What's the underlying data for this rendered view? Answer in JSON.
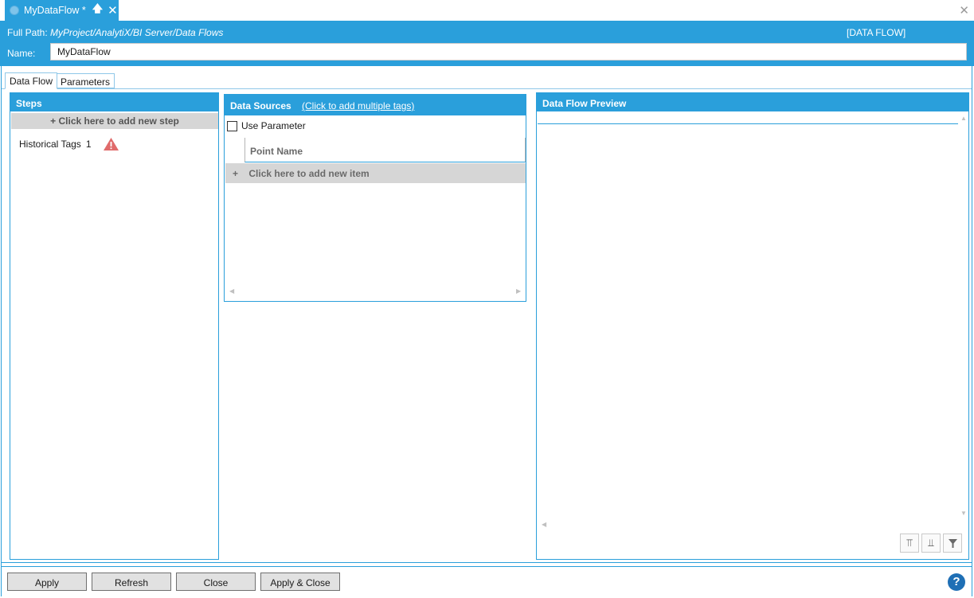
{
  "tab": {
    "title": "MyDataFlow *",
    "pin_icon": "pin-up-arrow-icon",
    "close_icon": "close-icon"
  },
  "window": {
    "close_icon": "close-icon"
  },
  "header": {
    "full_path_label": "Full Path:",
    "full_path_value": "MyProject/AnalytiX/BI Server/Data Flows",
    "kind": "[DATA FLOW]",
    "name_label": "Name:",
    "name_value": "MyDataFlow"
  },
  "subtabs": [
    {
      "label": "Data Flow",
      "selected": true
    },
    {
      "label": "Parameters",
      "selected": false
    }
  ],
  "steps": {
    "title": "Steps",
    "add_label": "+  Click here to add new step",
    "items": [
      {
        "label": "Historical Tags",
        "count": "1",
        "status_icon": "warning-icon"
      }
    ]
  },
  "data_sources": {
    "title": "Data Sources",
    "link": "(Click to add multiple tags)",
    "use_parameter_label": "Use Parameter",
    "use_parameter_checked": false,
    "column_header": "Point Name",
    "add_item_label": "Click here to add new item"
  },
  "preview": {
    "title": "Data Flow Preview",
    "toolbar_icons": [
      "column-add-icon",
      "column-remove-icon",
      "filter-icon"
    ]
  },
  "footer": {
    "buttons": [
      "Apply",
      "Refresh",
      "Close",
      "Apply & Close"
    ],
    "help_icon": "help-icon",
    "help_glyph": "?"
  },
  "colors": {
    "accent": "#2a9fdb",
    "button_bg": "#e1e1e1",
    "add_row_bg": "#d6d6d6",
    "warning": "#e06b6b"
  }
}
